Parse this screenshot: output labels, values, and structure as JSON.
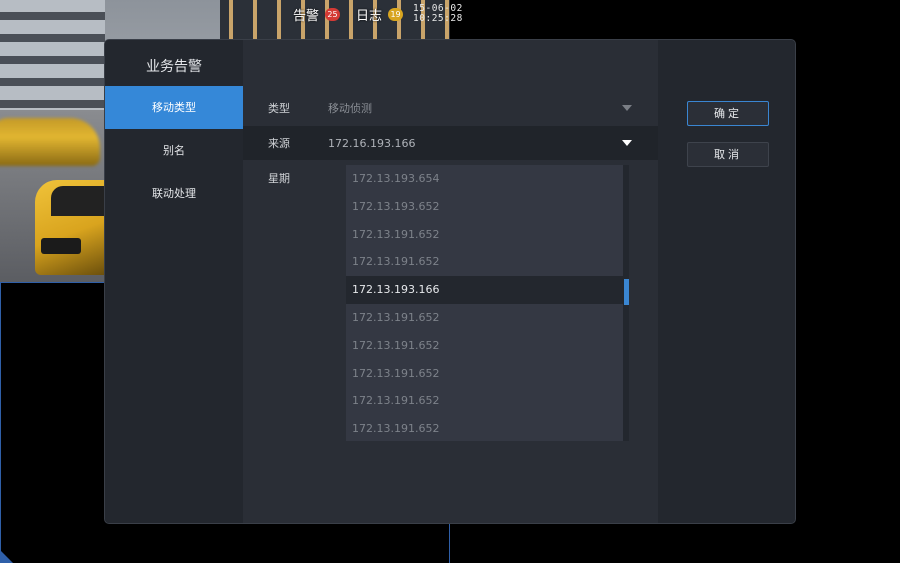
{
  "status": {
    "alarm_label": "告警",
    "alarm_count": "25",
    "log_label": "日志",
    "log_count": "19",
    "date": "15-06-02",
    "time": "10:25:28"
  },
  "dialog": {
    "title": "业务告警",
    "menu": [
      {
        "label": "移动类型",
        "active": true
      },
      {
        "label": "别名",
        "active": false
      },
      {
        "label": "联动处理",
        "active": false
      }
    ],
    "fields": {
      "type": {
        "label": "类型",
        "value": "移动侦测"
      },
      "source": {
        "label": "来源",
        "value": "172.16.193.166"
      },
      "week": {
        "label": "星期"
      }
    },
    "source_options": [
      "172.13.193.654",
      "172.13.193.652",
      "172.13.191.652",
      "172.13.191.652",
      "172.13.193.166",
      "172.13.191.652",
      "172.13.191.652",
      "172.13.191.652",
      "172.13.191.652",
      "172.13.191.652"
    ],
    "selected_option_index": 4,
    "buttons": {
      "ok": "确定",
      "cancel": "取消"
    }
  },
  "colors": {
    "accent": "#3588d8",
    "alarm_badge": "#d43a35",
    "log_badge": "#d8a520"
  }
}
